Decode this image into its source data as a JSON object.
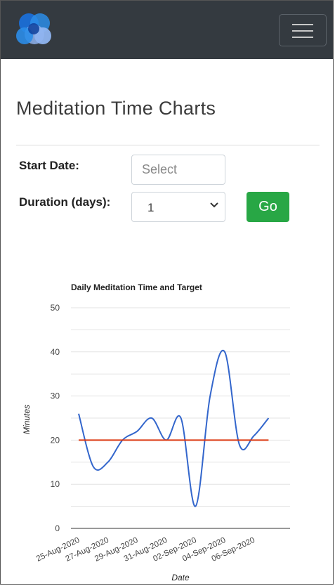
{
  "app": {
    "nav_menu_icon": "hamburger-icon",
    "logo_icon": "overlapping-circles-logo",
    "colors": {
      "navbar": "#343a40",
      "go_button": "#28a745",
      "series_line": "#3366cc",
      "target_line": "#dc3912",
      "logo_circle_1": "#1b6ed6",
      "logo_circle_2": "#2b8de8",
      "logo_circle_3": "#8fb4f0"
    }
  },
  "page": {
    "title": "Meditation Time Charts"
  },
  "form": {
    "start_date_label": "Start Date:",
    "start_date_placeholder": "Select",
    "start_date_value": "",
    "duration_label": "Duration (days):",
    "duration_value": "1",
    "go_label": "Go"
  },
  "chart_data": {
    "type": "line",
    "title": "Daily Meditation Time and Target",
    "xlabel": "Date",
    "ylabel": "Minutes",
    "ylim": [
      0,
      50
    ],
    "y_ticks": [
      0,
      10,
      20,
      30,
      40,
      50
    ],
    "x_tick_labels": [
      "25-Aug-2020",
      "27-Aug-2020",
      "29-Aug-2020",
      "31-Aug-2020",
      "02-Sep-2020",
      "04-Sep-2020",
      "06-Sep-2020"
    ],
    "x": [
      "25-Aug-2020",
      "26-Aug-2020",
      "27-Aug-2020",
      "28-Aug-2020",
      "29-Aug-2020",
      "30-Aug-2020",
      "31-Aug-2020",
      "01-Sep-2020",
      "02-Sep-2020",
      "03-Sep-2020",
      "04-Sep-2020",
      "05-Sep-2020",
      "06-Sep-2020",
      "07-Sep-2020"
    ],
    "series": [
      {
        "values": [
          26,
          14,
          15,
          20,
          22,
          25,
          20,
          25,
          5,
          30,
          40,
          19,
          21,
          25
        ]
      },
      {
        "values": [
          20,
          20,
          20,
          20,
          20,
          20,
          20,
          20,
          20,
          20,
          20,
          20,
          20,
          20
        ]
      }
    ],
    "grid": true,
    "legend": "none"
  }
}
